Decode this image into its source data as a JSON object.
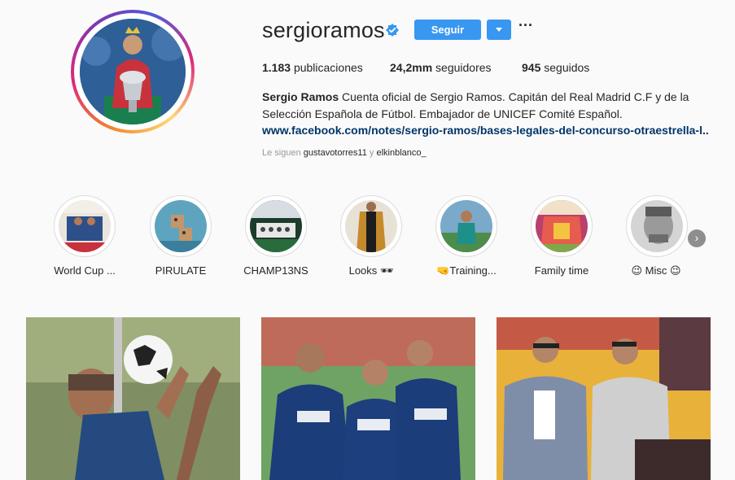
{
  "profile": {
    "username": "sergioramos",
    "verified": "verified-badge-icon",
    "follow_label": "Seguir",
    "stats": {
      "posts_value": "1.183",
      "posts_label": "publicaciones",
      "followers_value": "24,2mm",
      "followers_label": "seguidores",
      "following_value": "945",
      "following_label": "seguidos"
    },
    "bio_name": "Sergio Ramos",
    "bio_line1": "Cuenta oficial de Sergio Ramos. Capitán del Real Madrid C.F y de la",
    "bio_line2": "Selección Española de Fútbol. Embajador de UNICEF Comité Español.",
    "bio_link": "www.facebook.com/notes/sergio-ramos/bases-legales-del-concurso-otraestrella-l...",
    "followed_by_prefix": "Le siguen",
    "followed_by_user1": "gustavotorres11",
    "followed_by_joiner": "y",
    "followed_by_user2": "elkinblanco_"
  },
  "highlights": [
    {
      "label": "World Cup ..."
    },
    {
      "label": "PIRULATE"
    },
    {
      "label": "CHAMP13NS"
    },
    {
      "label": "Looks 🕶"
    },
    {
      "label": "🤜Training..."
    },
    {
      "label": "Family time"
    },
    {
      "label": "😉 Misc 😉"
    }
  ],
  "colors": {
    "accent": "#3897f0",
    "link": "#003569",
    "muted": "#999999"
  }
}
